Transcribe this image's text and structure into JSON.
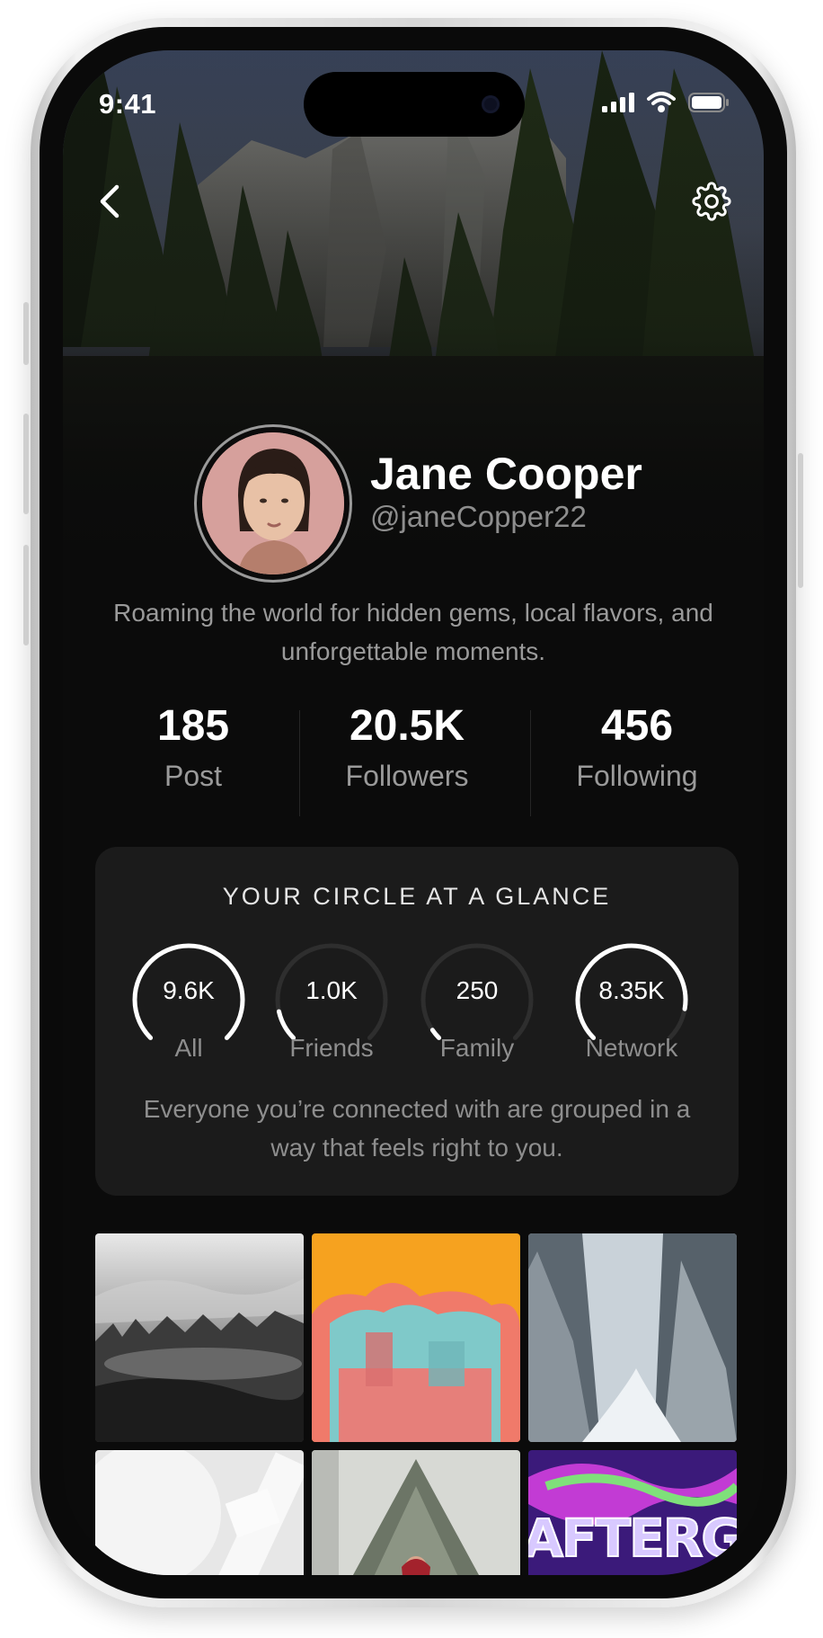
{
  "status_bar": {
    "time": "9:41",
    "signal_icon": "cellular-signal-icon",
    "wifi_icon": "wifi-icon",
    "battery_icon": "battery-icon"
  },
  "header": {
    "back_icon": "chevron-left-icon",
    "settings_icon": "gear-icon"
  },
  "profile": {
    "name": "Jane Cooper",
    "handle": "@janeCopper22",
    "bio": "Roaming the world for hidden gems, local flavors, and unforgettable moments."
  },
  "stats": [
    {
      "value": "185",
      "label": "Post"
    },
    {
      "value": "20.5K",
      "label": "Followers"
    },
    {
      "value": "456",
      "label": "Following"
    }
  ],
  "circle_card": {
    "title": "YOUR CIRCLE AT A GLANCE",
    "rings": [
      {
        "value": "9.6K",
        "label": "All",
        "fraction": 1.0
      },
      {
        "value": "1.0K",
        "label": "Friends",
        "fraction": 0.12
      },
      {
        "value": "250",
        "label": "Family",
        "fraction": 0.04
      },
      {
        "value": "8.35K",
        "label": "Network",
        "fraction": 0.87
      }
    ],
    "note": "Everyone you’re connected with are grouped in a way that feels right to you."
  },
  "gallery": {
    "tiles": [
      {
        "name": "foggy-forest-photo"
      },
      {
        "name": "abstract-orange-photo"
      },
      {
        "name": "snowy-forest-path-photo"
      },
      {
        "name": "white-product-photo"
      },
      {
        "name": "snowy-tree-person-photo"
      },
      {
        "name": "afterglow-graffiti-photo",
        "text": "AFTERGLOW"
      }
    ]
  },
  "colors": {
    "background": "#0b0b0b",
    "card": "#1b1b1b",
    "ring_active": "#ffffff",
    "ring_track": "#2e2e2e"
  }
}
